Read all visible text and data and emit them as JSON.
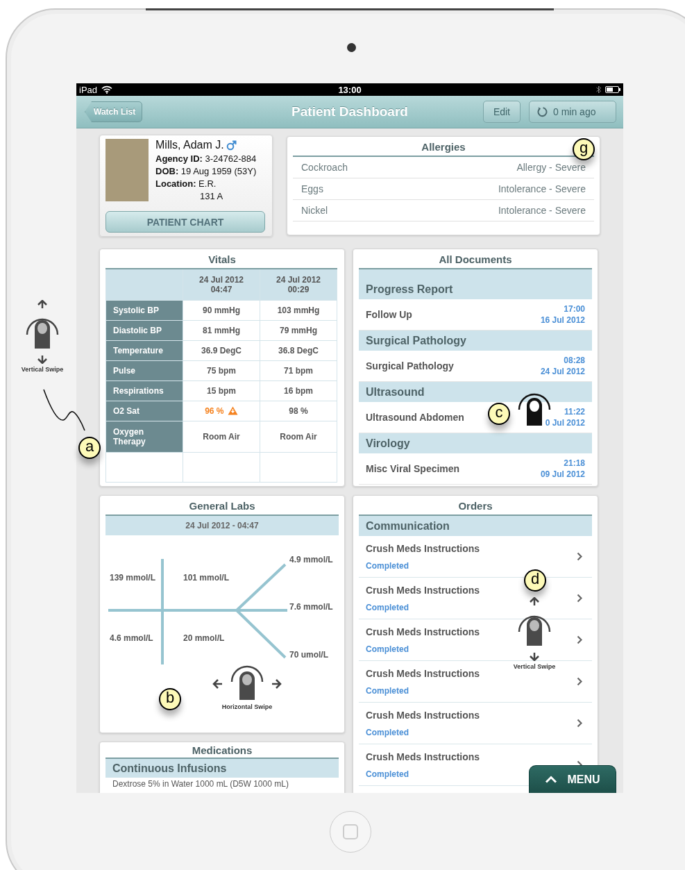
{
  "status_bar": {
    "device": "iPad",
    "time": "13:00"
  },
  "nav_bar": {
    "back": "Watch List",
    "title": "Patient Dashboard",
    "edit": "Edit",
    "refresh": "0 min ago"
  },
  "patient": {
    "name": "Mills, Adam J.",
    "fields": [
      {
        "label": "Agency ID:",
        "value": "3-24762-884"
      },
      {
        "label": "DOB:",
        "value": "19 Aug 1959 (53Y)"
      },
      {
        "label": "Location:",
        "value": "E.R."
      }
    ],
    "location_detail": "131 A",
    "chart_button": "PATIENT CHART"
  },
  "allergies": {
    "title": "Allergies",
    "rows": [
      {
        "name": "Cockroach",
        "reaction": "Allergy - Severe"
      },
      {
        "name": "Eggs",
        "reaction": "Intolerance - Severe"
      },
      {
        "name": "Nickel",
        "reaction": "Intolerance - Severe"
      }
    ]
  },
  "vitals": {
    "title": "Vitals",
    "columns": [
      "24 Jul 2012\n04:47",
      "24 Jul 2012\n00:29"
    ],
    "rows": [
      {
        "label": "Systolic BP",
        "values": [
          {
            "text": "90 mmHg",
            "alert": false
          },
          {
            "text": "103 mmHg",
            "alert": false
          }
        ]
      },
      {
        "label": "Diastolic BP",
        "values": [
          {
            "text": "81 mmHg",
            "alert": false
          },
          {
            "text": "79 mmHg",
            "alert": false
          }
        ]
      },
      {
        "label": "Temperature",
        "values": [
          {
            "text": "36.9 DegC",
            "alert": false
          },
          {
            "text": "36.8 DegC",
            "alert": false
          }
        ]
      },
      {
        "label": "Pulse",
        "values": [
          {
            "text": "75 bpm",
            "alert": false
          },
          {
            "text": "71 bpm",
            "alert": false
          }
        ]
      },
      {
        "label": "Respirations",
        "values": [
          {
            "text": "15 bpm",
            "alert": false
          },
          {
            "text": "16 bpm",
            "alert": false
          }
        ]
      },
      {
        "label": "O2 Sat",
        "values": [
          {
            "text": "96 %",
            "alert": true
          },
          {
            "text": "98 %",
            "alert": false
          }
        ]
      },
      {
        "label": "Oxygen Therapy",
        "values": [
          {
            "text": "Room Air",
            "alert": false
          },
          {
            "text": "Room Air",
            "alert": false
          }
        ]
      }
    ]
  },
  "documents": {
    "title": "All Documents",
    "groups": [
      {
        "title": "Progress Report",
        "items": [
          {
            "name": "Follow Up",
            "time": "17:00",
            "date": "16 Jul 2012"
          }
        ]
      },
      {
        "title": "Surgical Pathology",
        "items": [
          {
            "name": "Surgical Pathology",
            "time": "08:28",
            "date": "24 Jul 2012"
          }
        ]
      },
      {
        "title": "Ultrasound",
        "items": [
          {
            "name": "Ultrasound Abdomen",
            "time": "11:22",
            "date": "0 Jul 2012"
          }
        ]
      },
      {
        "title": "Virology",
        "items": [
          {
            "name": "Misc Viral Specimen",
            "time": "21:18",
            "date": "09 Jul 2012"
          }
        ]
      }
    ]
  },
  "general_labs": {
    "title": "General Labs",
    "date": "24 Jul 2012 - 04:47",
    "electrolytes": [
      "139 mmol/L",
      "101 mmol/L",
      "4.6 mmol/L",
      "20 mmol/L"
    ],
    "renal": [
      "4.9 mmol/L",
      "7.6 mmol/L",
      "70 umol/L"
    ]
  },
  "orders": {
    "title": "Orders",
    "section": "Communication",
    "items": [
      {
        "name": "Crush Meds Instructions",
        "status": "Completed"
      },
      {
        "name": "Crush Meds Instructions",
        "status": "Completed"
      },
      {
        "name": "Crush Meds Instructions",
        "status": "Completed"
      },
      {
        "name": "Crush Meds Instructions",
        "status": "Completed"
      },
      {
        "name": "Crush Meds Instructions",
        "status": "Completed"
      },
      {
        "name": "Crush Meds Instructions",
        "status": "Completed"
      }
    ]
  },
  "medications": {
    "title": "Medications",
    "section": "Continuous Infusions",
    "items": [
      "Dextrose 5% in Water 1000 mL (D5W 1000 mL)"
    ]
  },
  "menu_button": "MENU",
  "annotations": {
    "markers": [
      "g",
      "a",
      "b",
      "c",
      "d"
    ],
    "gestures": [
      {
        "kind": "vertical",
        "label": "Vertical Swipe"
      },
      {
        "kind": "tap"
      },
      {
        "kind": "horizontal",
        "label": "Horizontal Swipe"
      },
      {
        "kind": "vertical",
        "label": "Vertical Swipe"
      }
    ]
  }
}
